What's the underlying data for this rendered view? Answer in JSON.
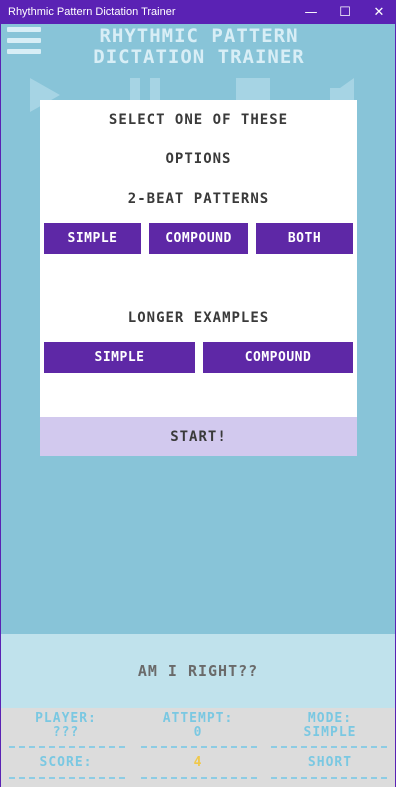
{
  "window": {
    "title": "Rhythmic Pattern Dictation Trainer",
    "minimize": "—",
    "maximize": "☐",
    "close": "✕"
  },
  "app": {
    "title_line1": "RHYTHMIC PATTERN",
    "title_line2": "DICTATION TRAINER"
  },
  "modal": {
    "heading_line1": "SELECT ONE OF THESE",
    "heading_line2": "OPTIONS",
    "section1_title": "2-BEAT PATTERNS",
    "section1_buttons": [
      "SIMPLE",
      "COMPOUND",
      "BOTH"
    ],
    "section2_title": "LONGER EXAMPLES",
    "section2_buttons": [
      "SIMPLE",
      "COMPOUND"
    ],
    "start_label": "START!"
  },
  "answer_bar": {
    "label": "AM I RIGHT??"
  },
  "stats": {
    "player_label": "PLAYER:",
    "player_value": "???",
    "attempt_label": "ATTEMPT:",
    "attempt_value": "0",
    "mode_label": "MODE:",
    "mode_value": "SIMPLE",
    "score_label": "SCORE:",
    "score_value": "4",
    "length_value": "SHORT"
  },
  "colors": {
    "titlebar": "#5a22b4",
    "background": "#88c4d8",
    "button": "#5e28a6",
    "start_bar": "#d2c9ee",
    "stat_text": "#7ac8e2",
    "score_highlight": "#f0c84a"
  }
}
